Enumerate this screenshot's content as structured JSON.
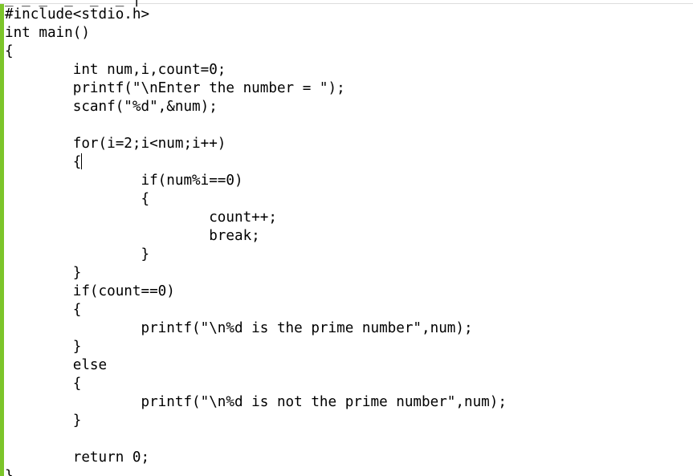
{
  "editor": {
    "top_clipped_text": "_ _ _  _  _  _ |",
    "lines": [
      "#include<stdio.h>",
      "int main()",
      "{",
      "        int num,i,count=0;",
      "        printf(\"\\nEnter the number = \");",
      "        scanf(\"%d\",&num);",
      "",
      "        for(i=2;i<num;i++)",
      "        {",
      "                if(num%i==0)",
      "                {",
      "                        count++;",
      "                        break;",
      "                }",
      "        }",
      "        if(count==0)",
      "        {",
      "                printf(\"\\n%d is the prime number\",num);",
      "        }",
      "        else",
      "        {",
      "                printf(\"\\n%d is not the prime number\",num);",
      "        }",
      "",
      "        return 0;",
      "}"
    ],
    "caret_line": 8,
    "colors": {
      "gutter_bar": "#7cc52a",
      "text": "#000000",
      "background": "#ffffff"
    }
  }
}
